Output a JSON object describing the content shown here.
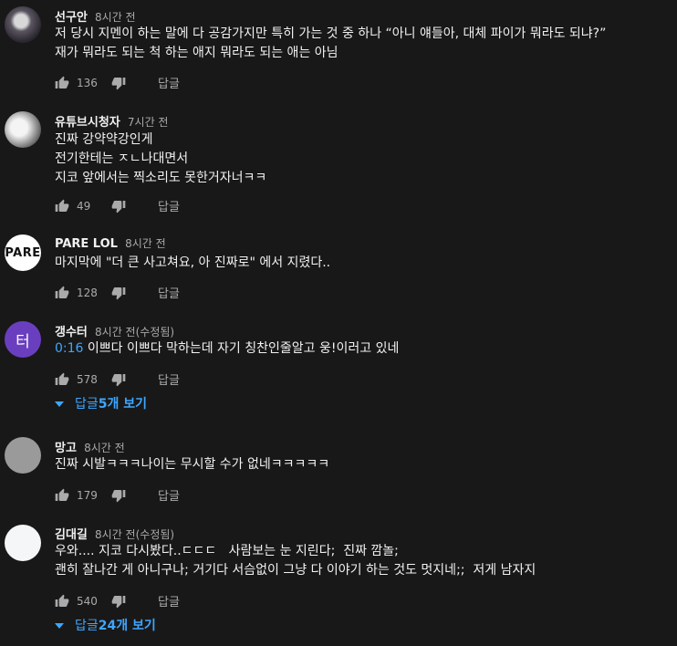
{
  "comments": [
    {
      "author": "선구안",
      "time": "8시간 전",
      "line1": "저 당시 지멘이 하는 말에 다 공감가지만 특히 가는 것 중 하나 “아니 얘들아, 대체 파이가 뭐라도 되냐?”",
      "line2": "재가 뭐라도 되는 척 하는 애지 뭐라도 되는 애는 아님",
      "likes": "136",
      "reply_label": "답글"
    },
    {
      "author": "유튜브시청자",
      "time": "7시간 전",
      "line1": "진짜 강약약강인게",
      "line2": "전기한테는 ㅈㄴ나대면서",
      "line3": "지코 앞에서는 찍소리도 못한거자너ㅋㅋ",
      "likes": "49",
      "reply_label": "답글"
    },
    {
      "author": "PARE LOL",
      "avatar_text": "PARE",
      "time": "8시간 전",
      "line1": "마지막에 \"더 큰 사고쳐요, 아 진짜로\" 에서 지렸다..",
      "likes": "128",
      "reply_label": "답글"
    },
    {
      "author": "갱수터",
      "avatar_text": "터",
      "time": "8시간 전(수정됨)",
      "timestamp": "0:16",
      "line1": " 이쁘다 이쁘다 막하는데 자기 칭찬인줄알고 웅!이러고 있네",
      "likes": "578",
      "reply_label": "답글",
      "view_replies_prefix": "답글 ",
      "view_replies_count": "5개 보기"
    },
    {
      "author": "망고",
      "time": "8시간 전",
      "line1": "진짜 시발ㅋㅋㅋ나이는 무시할 수가 없네ㅋㅋㅋㅋㅋ",
      "likes": "179",
      "reply_label": "답글"
    },
    {
      "author": "김대길",
      "time": "8시간 전(수정됨)",
      "line1": "우와.... 지코 다시봤다..ㄷㄷㄷ   사람보는 눈 지린다;  진짜 깜놀;",
      "line2": "괜히 잘나간 게 아니구나; 거기다 서슴없이 그냥 다 이야기 하는 것도 멋지네;;  저게 남자지",
      "likes": "540",
      "reply_label": "답글",
      "view_replies_prefix": "답글 ",
      "view_replies_count": "24개 보기"
    }
  ],
  "colors": {
    "background": "#181818",
    "text": "#f1f1f1",
    "secondary": "#aaaaaa",
    "link": "#3ea6ff"
  }
}
